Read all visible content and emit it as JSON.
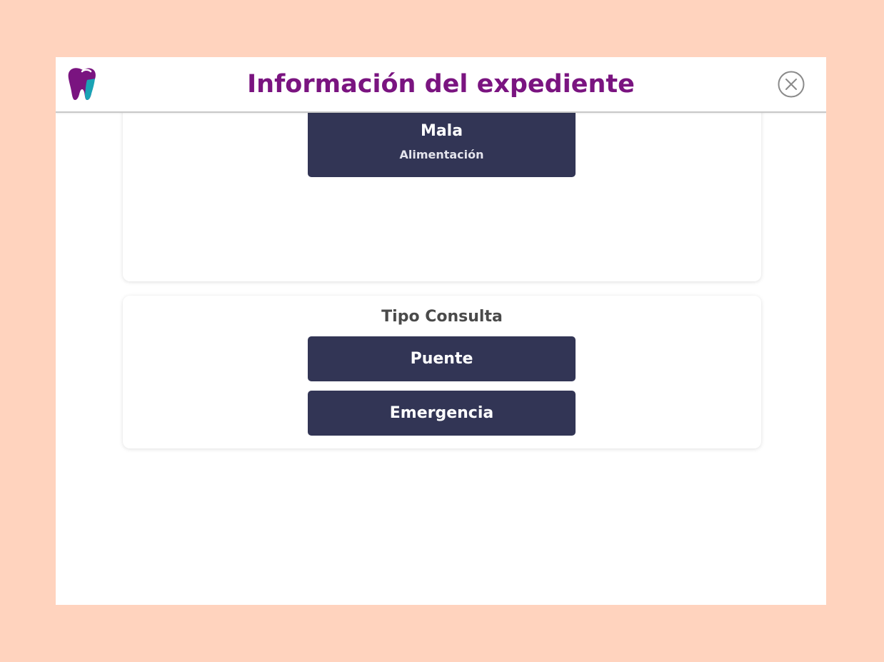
{
  "header": {
    "title": "Información del expediente",
    "logo_icon": "tooth-icon",
    "close_icon": "close-circle-icon",
    "brand_color": "#7A1480",
    "accent_color": "#1AA3B5"
  },
  "habits_card": {
    "item": {
      "value": "Mala",
      "caption": "Alimentación"
    }
  },
  "consult_card": {
    "title": "Tipo Consulta",
    "options": [
      "Puente",
      "Emergencia"
    ]
  },
  "colors": {
    "page_background": "#FFD3BE",
    "pill_background": "#323555"
  }
}
